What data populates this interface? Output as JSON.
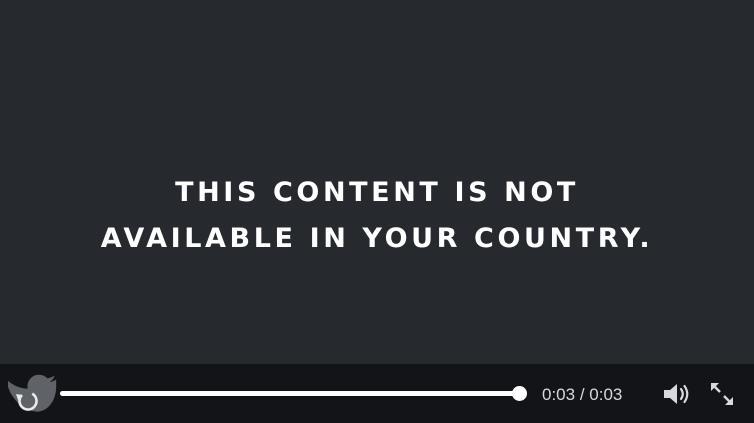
{
  "video": {
    "message_line1": "THIS CONTENT IS NOT",
    "message_line2": "AVAILABLE IN YOUR COUNTRY."
  },
  "controls": {
    "current_time": "0:03",
    "separator": "/",
    "duration": "0:03",
    "progress_fraction": 1.0,
    "icons": {
      "replay": "replay-icon",
      "twitter_bird": "twitter-bird-icon",
      "volume": "volume-icon",
      "fullscreen": "fullscreen-icon"
    }
  },
  "colors": {
    "video_background": "#26292e",
    "controls_background": "#121417",
    "progress_fill": "#ffffff",
    "progress_track": "#5a5d62",
    "text": "#ffffff"
  }
}
